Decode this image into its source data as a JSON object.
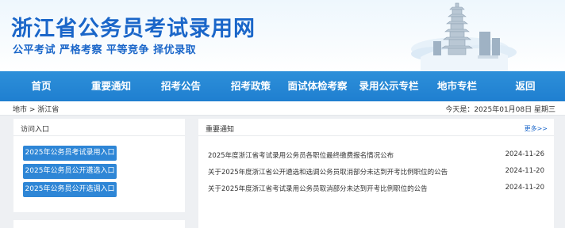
{
  "header": {
    "site_title": "浙江省公务员考试录用网",
    "slogan": "公平考试 严格考察 平等竞争 择优录取"
  },
  "nav": {
    "items": [
      {
        "label": "首页"
      },
      {
        "label": "重要通知"
      },
      {
        "label": "招考公告"
      },
      {
        "label": "招考政策"
      },
      {
        "label": "面试体检考察"
      },
      {
        "label": "录用公示专栏"
      },
      {
        "label": "地市专栏"
      },
      {
        "label": "返回"
      }
    ]
  },
  "breadcrumb": {
    "text": "地市 > 浙江省"
  },
  "today": {
    "text": "今天是：2025年01月08日 星期三"
  },
  "access_panel": {
    "title": "访问入口",
    "buttons": [
      {
        "label": "2025年公务员考试录用入口"
      },
      {
        "label": "2025年公务员公开遴选入口"
      },
      {
        "label": "2025年公务员公开选调入口"
      }
    ]
  },
  "notice_panel": {
    "title": "重要通知",
    "more_label": "更多>>",
    "items": [
      {
        "title": "2025年度浙江省考试录用公务员各职位最终缴费报名情况公布",
        "date": "2024-11-26"
      },
      {
        "title": "关于2025年度浙江省公开遴选和选调公务员取消部分未达到开考比例职位的公告",
        "date": "2024-11-20"
      },
      {
        "title": "关于2025年度浙江省考试录用公务员取消部分未达到开考比例职位的公告",
        "date": "2024-11-20"
      }
    ]
  },
  "colors": {
    "brand_blue": "#1a66c9",
    "nav_blue": "#1f7fd0",
    "button_blue": "#2e86d6",
    "page_gray": "#eef0f3"
  },
  "icons": {
    "banner_decoration": "pagoda-illustration"
  }
}
